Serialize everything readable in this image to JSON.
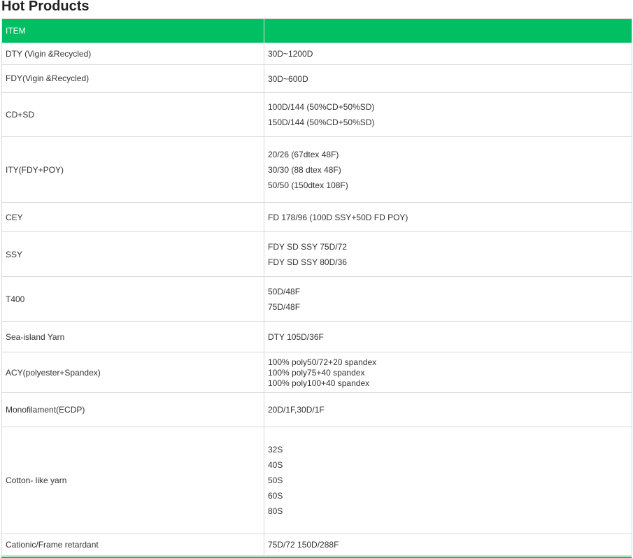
{
  "page": {
    "title": "Hot Products"
  },
  "table": {
    "headers": [
      "ITEM",
      ""
    ],
    "rows": [
      {
        "item": "DTY (Vigin &Recycled)",
        "specs": [
          "30D~1200D"
        ]
      },
      {
        "item": "FDY(Vigin &Recycled)",
        "specs": [
          "30D~600D"
        ]
      },
      {
        "item": "CD+SD",
        "specs": [
          "100D/144 (50%CD+50%SD)",
          "150D/144 (50%CD+50%SD)"
        ]
      },
      {
        "item": "ITY(FDY+POY)",
        "specs": [
          "20/26 (67dtex 48F)",
          "30/30 (88 dtex 48F)",
          "50/50 (150dtex 108F)"
        ]
      },
      {
        "item": "CEY",
        "specs": [
          "FD 178/96 (100D SSY+50D FD POY)"
        ]
      },
      {
        "item": "SSY",
        "specs": [
          "FDY SD SSY 75D/72",
          "FDY SD SSY 80D/36"
        ]
      },
      {
        "item": "T400",
        "specs": [
          "50D/48F",
          "75D/48F"
        ]
      },
      {
        "item": "Sea-island Yarn",
        "specs": [
          "DTY 105D/36F"
        ]
      },
      {
        "item": "ACY(polyester+Spandex)",
        "specs": [
          "100% poly50/72+20 spandex",
          "100% poly75+40 spandex",
          "100% poly100+40 spandex"
        ]
      },
      {
        "item": "Monofilament(ECDP)",
        "specs": [
          "20D/1F,30D/1F"
        ]
      },
      {
        "item": "Cotton- like yarn",
        "specs": [
          "32S",
          "40S",
          "50S",
          "60S",
          "80S"
        ]
      },
      {
        "item": "Cationic/Frame retardant",
        "specs": [
          "75D/72 150D/288F"
        ]
      }
    ]
  },
  "colors": {
    "header_bg": "#00bf63",
    "border": "#d9d9d9"
  }
}
